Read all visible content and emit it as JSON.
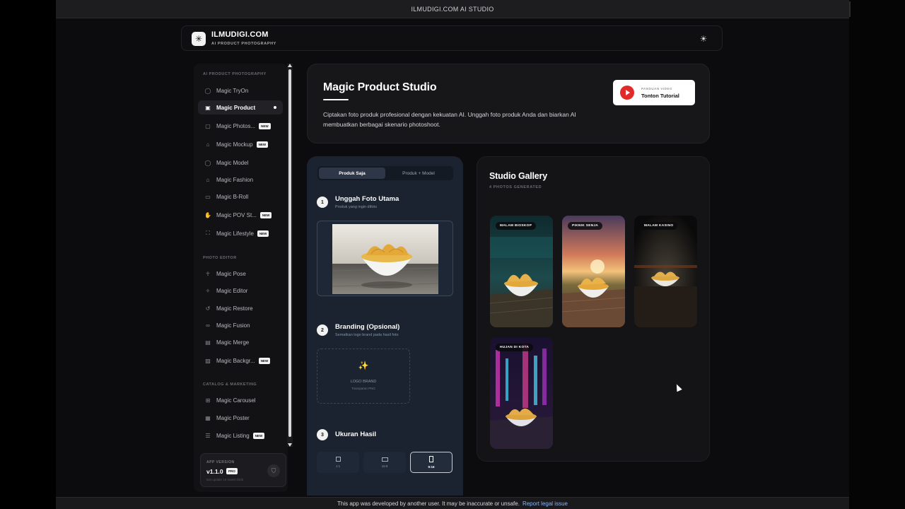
{
  "window": {
    "title": "ILMUDIGI.COM AI STUDIO"
  },
  "header": {
    "brand": "ILMUDIGI.COM",
    "tagline": "AI PRODUCT PHOTOGRAPHY",
    "theme_icon": "sun-icon"
  },
  "sidebar": {
    "sections": [
      {
        "label": "AI PRODUCT PHOTOGRAPHY"
      },
      {
        "label": "PHOTO EDITOR"
      },
      {
        "label": "CATALOG & MARKETING"
      }
    ],
    "items": [
      {
        "label": "Magic TryOn",
        "icon": "person-icon"
      },
      {
        "label": "Magic Product",
        "icon": "camera-icon",
        "active": true
      },
      {
        "label": "Magic Photos...",
        "icon": "photo-icon",
        "badge": "NEW"
      },
      {
        "label": "Magic Mockup",
        "icon": "shirt-icon",
        "badge": "NEW"
      },
      {
        "label": "Magic Model",
        "icon": "person-icon"
      },
      {
        "label": "Magic Fashion",
        "icon": "shirt-icon"
      },
      {
        "label": "Magic B-Roll",
        "icon": "video-icon"
      },
      {
        "label": "Magic POV St...",
        "icon": "hand-icon",
        "badge": "NEW"
      },
      {
        "label": "Magic Lifestyle",
        "icon": "scan-icon",
        "badge": "NEW"
      },
      {
        "label": "Magic Pose",
        "icon": "figure-icon"
      },
      {
        "label": "Magic Editor",
        "icon": "sparkle-icon"
      },
      {
        "label": "Magic Restore",
        "icon": "history-icon"
      },
      {
        "label": "Magic Fusion",
        "icon": "rings-icon"
      },
      {
        "label": "Magic Merge",
        "icon": "layers-icon"
      },
      {
        "label": "Magic Backgr...",
        "icon": "image-icon",
        "badge": "NEW"
      },
      {
        "label": "Magic Carousel",
        "icon": "plus-square-icon"
      },
      {
        "label": "Magic Poster",
        "icon": "poster-icon"
      },
      {
        "label": "Magic Listing",
        "icon": "list-icon",
        "badge": "NEW"
      }
    ],
    "version": {
      "label": "APP VERSION",
      "number": "v1.1.0",
      "tier": "PRO",
      "updated": "last update 10 maret 2026"
    }
  },
  "hero": {
    "title": "Magic Product Studio",
    "description": "Ciptakan foto produk profesional dengan kekuatan AI. Unggah foto produk Anda dan biarkan AI membuatkan berbagai skenario photoshoot.",
    "tutorial": {
      "label": "PANDUAN VIDEO",
      "action": "Tonton Tutorial"
    }
  },
  "panel": {
    "modes": [
      "Produk Saja",
      "Produk + Model"
    ],
    "steps": [
      {
        "num": "1",
        "title": "Unggah Foto Utama",
        "sub": "Produk yang ingin difoto"
      },
      {
        "num": "2",
        "title": "Branding (Opsional)",
        "sub": "Sematkan logo brand pada hasil foto"
      },
      {
        "num": "3",
        "title": "Ukuran Hasil",
        "sub": ""
      }
    ],
    "logo_drop": {
      "title": "LOGO BRAND",
      "sub": "Transparan PNG"
    },
    "ratios": [
      "1:1",
      "16:9",
      "9:16"
    ],
    "selected_ratio": "9:16"
  },
  "gallery": {
    "title": "Studio Gallery",
    "count_label": "4 PHOTOS GENERATED",
    "photos": [
      {
        "tag": "MALAM BIOSKOP"
      },
      {
        "tag": "PIKNIK SENJA"
      },
      {
        "tag": "MALAM KASINO"
      },
      {
        "tag": "HUJAN DI KOTA"
      }
    ]
  },
  "footer": {
    "notice": "This app was developed by another user. It may be inaccurate or unsafe.",
    "link": "Report legal issue"
  },
  "colors": {
    "accent": "#ffffff",
    "panel_bg": "#1b2330",
    "tutorial_red": "#e22a2a",
    "link": "#8ab4f8"
  }
}
